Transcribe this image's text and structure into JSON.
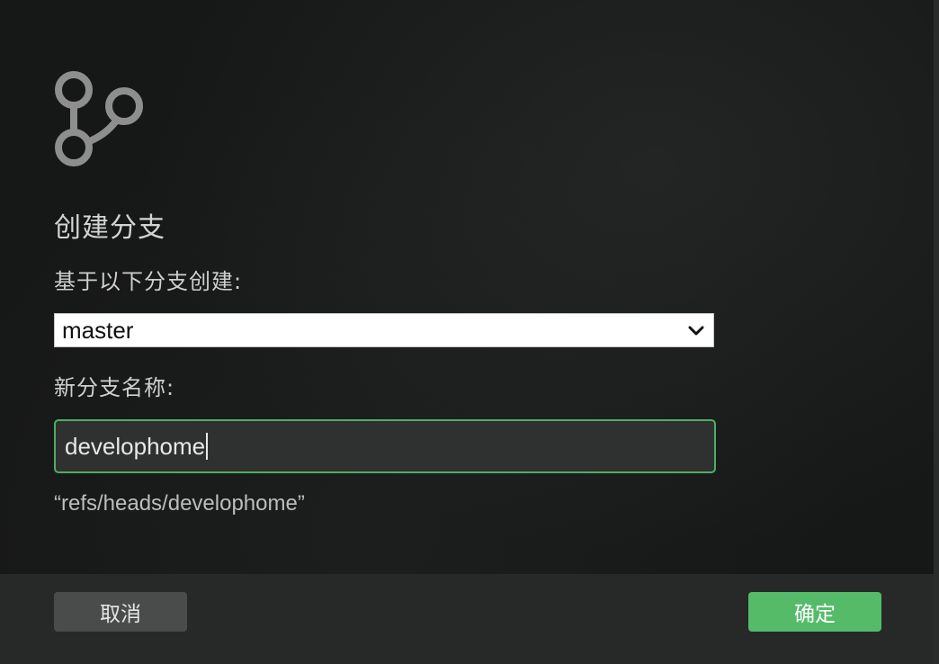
{
  "dialog": {
    "icon": "git-branch-icon",
    "title": "创建分支",
    "base_label": "基于以下分支创建:",
    "base_branch": {
      "selected": "master",
      "icon": "chevron-down-icon"
    },
    "name_label": "新分支名称:",
    "name_input": {
      "value": "develophome"
    },
    "ref_preview": "“refs/heads/develophome”"
  },
  "footer": {
    "cancel_label": "取消",
    "ok_label": "确定"
  },
  "colors": {
    "accent": "#55bb69",
    "focus_border": "#4cae63",
    "background": "#161717",
    "footer": "#272828"
  }
}
